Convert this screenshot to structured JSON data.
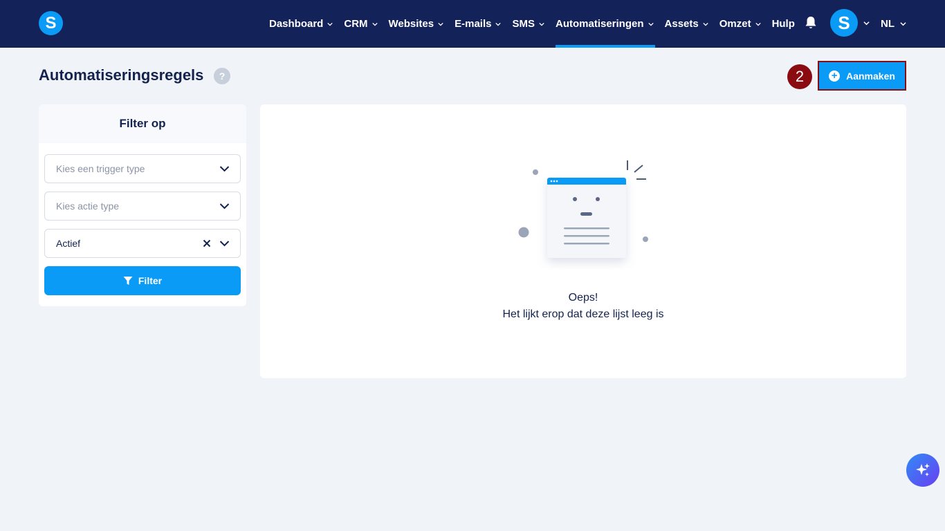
{
  "brand": {
    "logo_letter": "S",
    "avatar_letter": "S"
  },
  "nav": {
    "items": [
      {
        "label": "Dashboard",
        "has_dropdown": true
      },
      {
        "label": "CRM",
        "has_dropdown": true
      },
      {
        "label": "Websites",
        "has_dropdown": true
      },
      {
        "label": "E-mails",
        "has_dropdown": true
      },
      {
        "label": "SMS",
        "has_dropdown": true
      },
      {
        "label": "Automatiseringen",
        "has_dropdown": true,
        "active": true
      },
      {
        "label": "Assets",
        "has_dropdown": true
      },
      {
        "label": "Omzet",
        "has_dropdown": true
      },
      {
        "label": "Hulp",
        "has_dropdown": false
      }
    ],
    "language": "NL"
  },
  "page": {
    "title": "Automatiseringsregels",
    "help_glyph": "?",
    "step_badge": "2",
    "create_label": "Aanmaken"
  },
  "filter": {
    "heading": "Filter op",
    "trigger_placeholder": "Kies een trigger type",
    "action_placeholder": "Kies actie type",
    "status_value": "Actief",
    "button_label": "Filter"
  },
  "empty_state": {
    "title": "Oeps!",
    "message": "Het lijkt erop dat deze lijst leeg is"
  },
  "icons": {
    "bell": "bell-icon",
    "chevron": "chevron-down-icon",
    "clear": "close-icon",
    "filter": "funnel-icon",
    "plus": "plus-circle-icon",
    "ai": "sparkles-icon"
  },
  "colors": {
    "nav_bg": "#14225a",
    "accent": "#0a9bf6",
    "badge": "#8b0c10",
    "page_bg": "#f0f3f8"
  }
}
